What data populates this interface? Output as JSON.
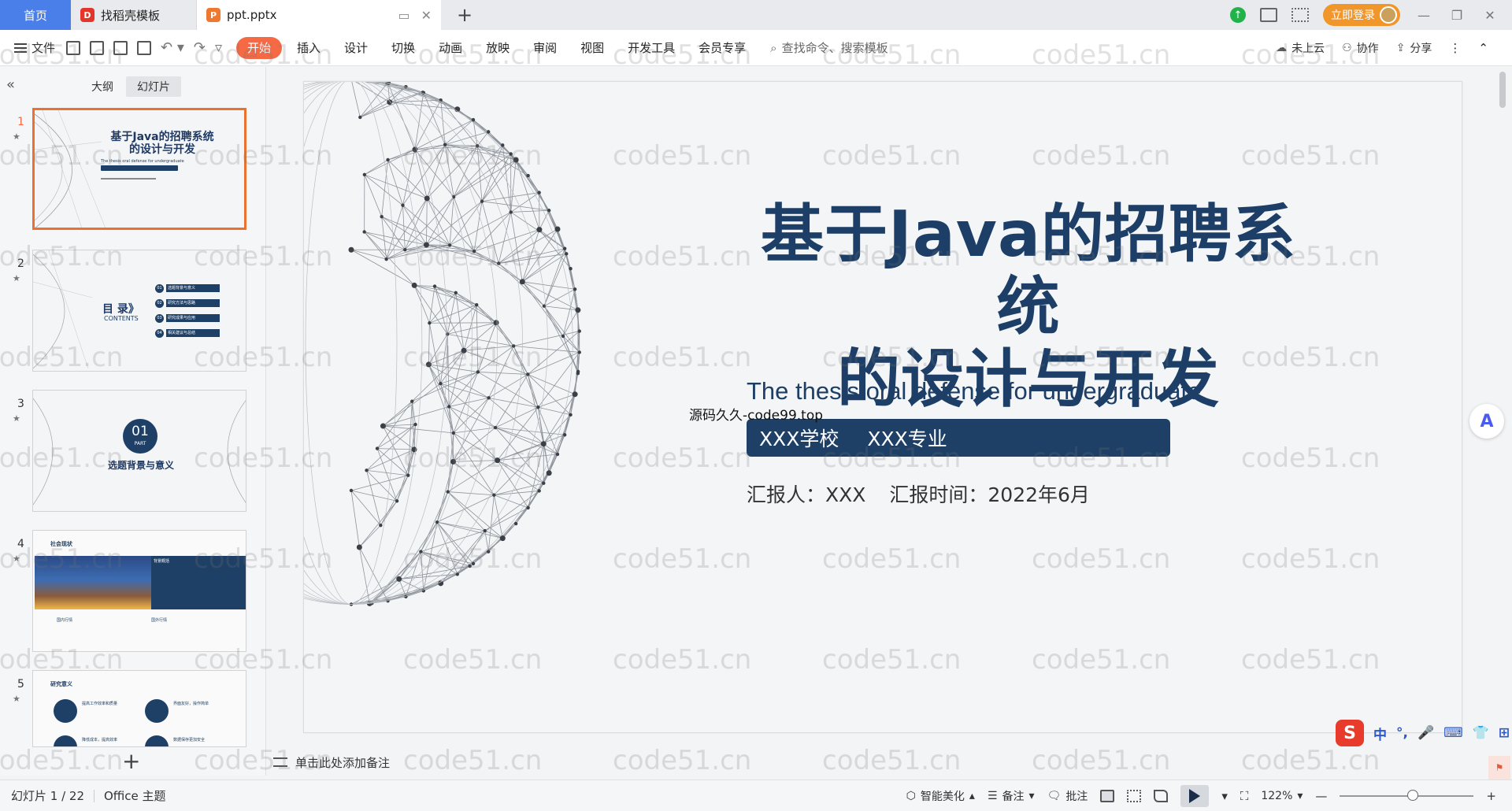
{
  "titlebar": {
    "home_tab": "首页",
    "daoke_tab": "找稻壳模板",
    "doc_tab": "ppt.pptx",
    "new_tab_symbol": "+",
    "login_label": "立即登录"
  },
  "ribbon": {
    "file_label": "文件",
    "tabs": [
      "开始",
      "插入",
      "设计",
      "切换",
      "动画",
      "放映",
      "审阅",
      "视图",
      "开发工具",
      "会员专享"
    ],
    "search_placeholder": "查找命令、搜索模板",
    "cloud_label": "未上云",
    "collab_label": "协作",
    "share_label": "分享"
  },
  "left_panel": {
    "tab_outline": "大纲",
    "tab_slides": "幻灯片",
    "slides": [
      {
        "num": "1",
        "title_line1": "基于Java的招聘系统",
        "title_line2": "的设计与开发",
        "sub": "The thesis oral defense for undergraduate"
      },
      {
        "num": "2",
        "title": "目 录》",
        "contents": "CONTENTS",
        "items": [
          "选题背景与意义",
          "研究方法与思路",
          "研究成果与应用",
          "相关建议与总结"
        ],
        "item_nums": [
          "01",
          "02",
          "03",
          "04"
        ]
      },
      {
        "num": "3",
        "part_num": "01",
        "part_label": "PART",
        "title": "选题背景与意义"
      },
      {
        "num": "4",
        "title": "社会现状",
        "box_title": "背景概括",
        "item1": "国内行情",
        "item2": "国外行情"
      },
      {
        "num": "5",
        "title": "研究意义",
        "item1": "提高工作效率和质量",
        "item2": "界面友好，操作简单",
        "item3": "降低成本，提高效率",
        "item4": "数据保存更加安全"
      }
    ]
  },
  "slide": {
    "title_line1": "基于Java的招聘系统",
    "title_line2": "的设计与开发",
    "subtitle": "The thesis oral defense for undergraduate",
    "school": "XXX学校",
    "major": "XXX专业",
    "reporter": "汇报人：XXX",
    "report_time": "汇报时间：2022年6月"
  },
  "overlay_text": "源码久久-code99.top",
  "notes_placeholder": "单击此处添加备注",
  "ime": {
    "zh": "中"
  },
  "statusbar": {
    "slide_counter": "幻灯片 1 / 22",
    "theme": "Office 主题",
    "beautify": "智能美化",
    "notes": "备注",
    "comments": "批注",
    "zoom": "122%"
  },
  "watermark": "code51.cn",
  "colors": {
    "accent": "#f56a45",
    "home_tab": "#4a7ee8",
    "slide_blue": "#1d3f67",
    "login": "#f0962b"
  }
}
